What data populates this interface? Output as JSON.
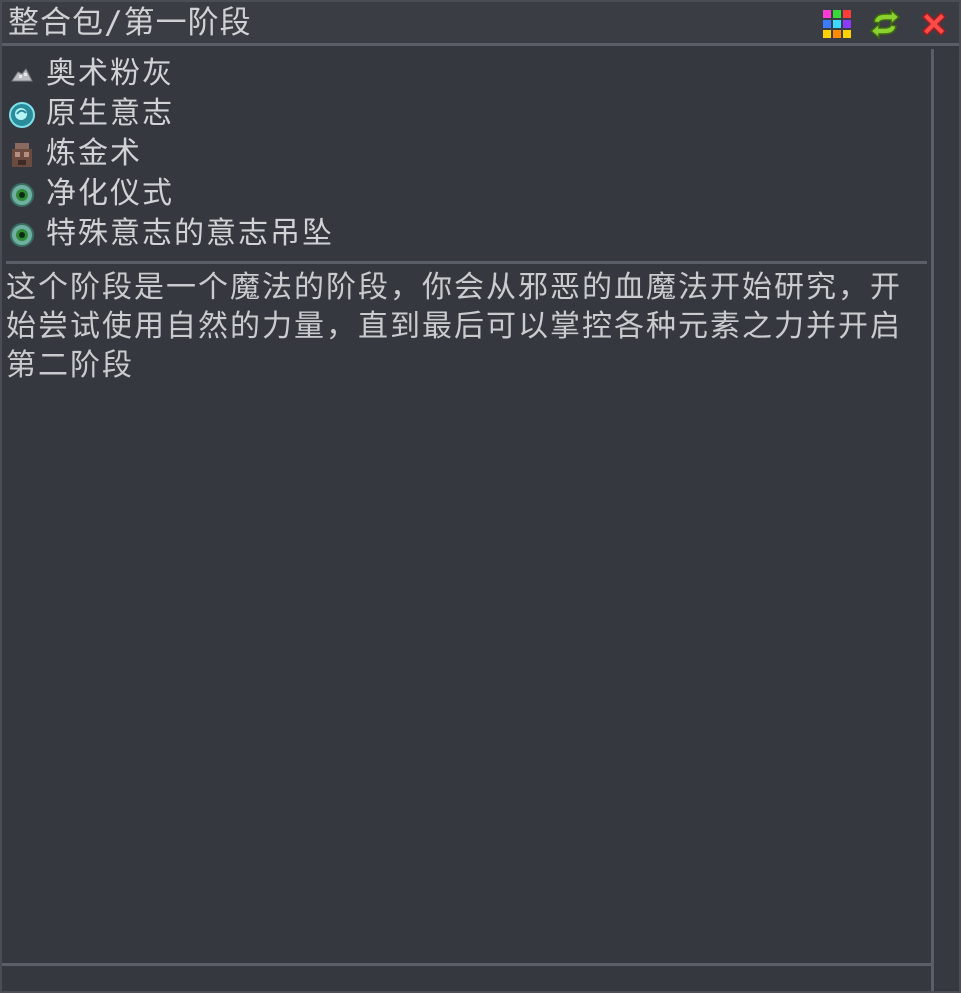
{
  "window": {
    "title": "整合包/第一阶段"
  },
  "toolbar": {
    "buttons": [
      {
        "icon": "grid-icon",
        "colors": [
          "#ff3b3b",
          "#ffd200",
          "#3b7bff",
          "#38d838",
          "#ff5bd6",
          "#3bd9ff"
        ]
      },
      {
        "icon": "refresh-icon",
        "color": "#8bd12f"
      },
      {
        "icon": "close-icon",
        "color": "#ff4a4a"
      }
    ]
  },
  "tasks": [
    {
      "label": "奥术粉灰",
      "icon": "arcane-dust-icon"
    },
    {
      "label": "原生意志",
      "icon": "raw-will-icon"
    },
    {
      "label": "炼金术",
      "icon": "alchemy-icon"
    },
    {
      "label": "净化仪式",
      "icon": "purification-ritual-icon"
    },
    {
      "label": "特殊意志的意志吊坠",
      "icon": "will-pendant-icon"
    }
  ],
  "description": "这个阶段是一个魔法的阶段，你会从邪恶的血魔法开始研究，开始尝试使用自然的力量，直到最后可以掌控各种元素之力并开启第二阶段"
}
